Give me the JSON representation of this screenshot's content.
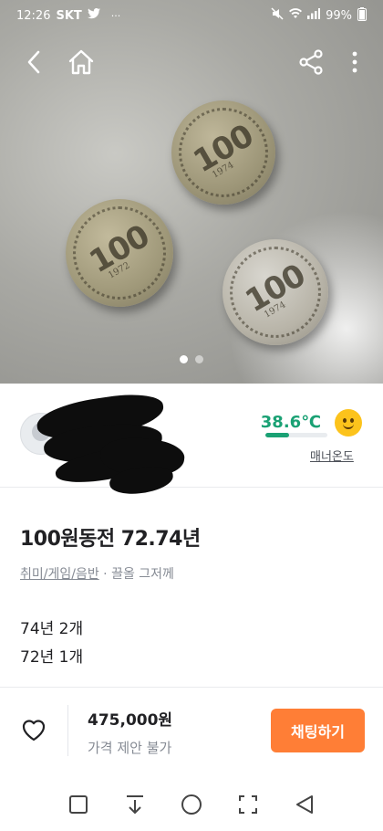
{
  "status_bar": {
    "time": "12:26",
    "carrier": "SKT",
    "extra": "···",
    "battery": "99%"
  },
  "photo": {
    "coins": [
      {
        "value": "100",
        "year": "1974"
      },
      {
        "value": "100",
        "year": "1972"
      },
      {
        "value": "100",
        "year": "1974"
      }
    ],
    "page_count": 2,
    "current_page": 1
  },
  "seller": {
    "temperature": "38.6℃",
    "temperature_level": 0.386,
    "manner_label": "매너온도"
  },
  "item": {
    "title": "100원동전 72.74년",
    "category": "취미/게임/음반",
    "separator": " · ",
    "posted": "끌올 그저께",
    "description_lines": [
      "74년 2개",
      "72년 1개"
    ]
  },
  "bottom": {
    "price": "475,000원",
    "negotiation": "가격 제안 불가",
    "chat_button": "채팅하기"
  },
  "colors": {
    "accent": "#ff7e36",
    "temperature": "#1aa174"
  }
}
